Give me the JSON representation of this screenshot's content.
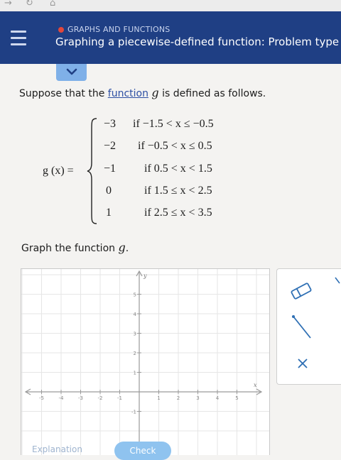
{
  "header": {
    "topic": "GRAPHS AND FUNCTIONS",
    "title": "Graphing a piecewise-defined function: Problem type",
    "topic_dot_color": "#e2473b",
    "background_color": "#1f3f84"
  },
  "problem": {
    "intro_before": "Suppose that the",
    "intro_link": "function",
    "intro_var": "g",
    "intro_after": "is defined as follows.",
    "function_label": "g (x) =",
    "cases": [
      {
        "value": "−3",
        "condition": "if −1.5 < x ≤ −0.5"
      },
      {
        "value": "−2",
        "condition": "if −0.5 < x ≤ 0.5"
      },
      {
        "value": "−1",
        "condition": "if 0.5 < x < 1.5"
      },
      {
        "value": "0",
        "condition": "if 1.5 ≤ x < 2.5"
      },
      {
        "value": "1",
        "condition": "if 2.5 ≤ x < 3.5"
      }
    ],
    "graph_prompt": "Graph the function",
    "graph_prompt_var": "g"
  },
  "graph": {
    "x_axis_label": "x",
    "y_axis_label": "y",
    "x_ticks": [
      "-5",
      "-4",
      "-3",
      "-2",
      "-1",
      "1",
      "2",
      "3",
      "4",
      "5"
    ],
    "y_ticks": [
      "5",
      "4",
      "3",
      "2",
      "1",
      "-1"
    ],
    "x_range": [
      -6,
      6
    ],
    "y_range": [
      -2,
      6
    ],
    "grid": true
  },
  "tools": {
    "eraser": "eraser-icon",
    "segment": "line-segment-icon",
    "clear": "clear-x-icon"
  },
  "footer": {
    "explanation_label": "Explanation",
    "check_label": "Check"
  }
}
